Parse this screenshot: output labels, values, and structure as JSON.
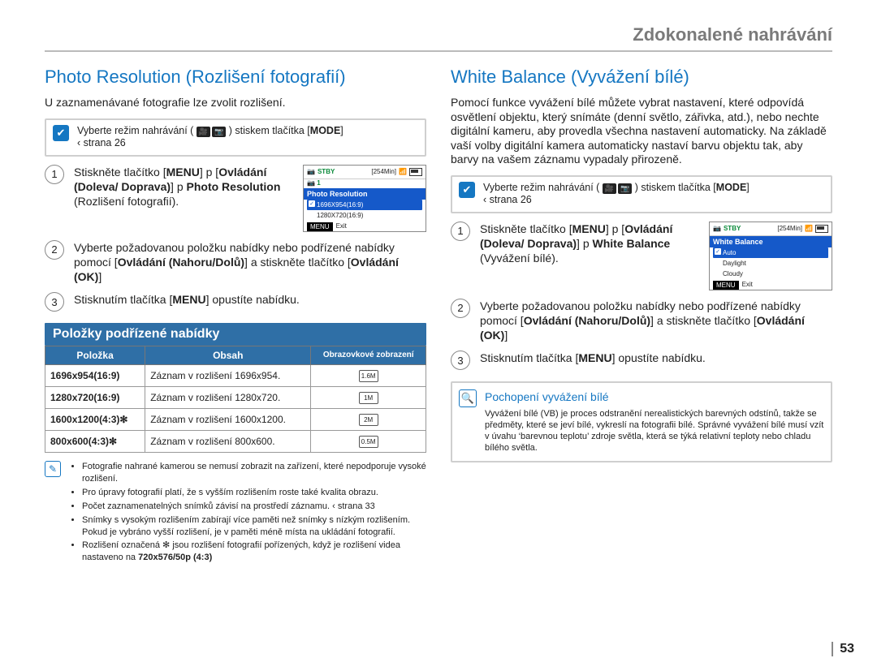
{
  "header": {
    "title": "Zdokonalené nahrávání"
  },
  "left": {
    "heading": "Photo Resolution (Rozlišení fotografií)",
    "lead": "U zaznamenávané fotografie lze zvolit rozlišení.",
    "hint_pre": "Vyberte režim nahrávání (",
    "hint_post": ") stiskem tlačítka [",
    "mode": "MODE",
    "hint_tail": "] ",
    "hint_page": "‹ strana 26",
    "step1_a": "Stiskněte tlačítko [",
    "menu": "MENU",
    "step1_b": "]  p [",
    "ctrl_lr": "Ovládání (Doleva/ Doprava)",
    "step1_c": "]  p ",
    "photo_res_b": "Photo Resolution",
    "photo_res_tail": " (Rozlišení fotografií).",
    "step2_a": "Vyberte požadovanou položku nabídky nebo podřízené nabídky pomocí [",
    "ctrl_ud": "Ovládání (Nahoru/Dolů)",
    "step2_b": "]  a stiskněte tlačítko [",
    "ctrl_ok": "Ovládání (OK)",
    "step2_c": "] ",
    "step3_a": "Stisknutím tlačítka [",
    "step3_b": "] opustíte nabídku.",
    "shot1": {
      "stby": "STBY",
      "time": "[254Min]",
      "title": "Photo Resolution",
      "sel": "1696X954(16:9)",
      "opt": "1280X720(16:9)",
      "exit": "Exit",
      "menu": "MENU"
    },
    "banner": "Položky podřízené nabídky",
    "th1": "Položka",
    "th2": "Obsah",
    "th3": "Obrazovkové zobrazení",
    "rows": [
      {
        "k": "1696x954(16:9)",
        "d": "Záznam v rozlišení 1696x954."
      },
      {
        "k": "1280x720(16:9)",
        "d": "Záznam v rozlišení 1280x720."
      },
      {
        "k": "1600x1200(4:3)✻",
        "d": "Záznam v rozlišení 1600x1200."
      },
      {
        "k": "800x600(4:3)✻",
        "d": "Záznam v rozlišení 800x600."
      }
    ],
    "notes": [
      "Fotografie nahrané kamerou se nemusí zobrazit na zařízení, které nepodporuje vysoké rozlišení.",
      "Pro úpravy fotografií platí, že s vyšším rozlišením roste také kvalita obrazu.",
      "Počet zaznamenatelných snímků závisí na prostředí záznamu.  ‹ strana 33",
      "Snímky s vysokým rozlišením zabírají více paměti než snímky s nízkým rozlišením. Pokud je vybráno vyšší rozlišení, je v paměti méně místa na ukládání fotografií."
    ],
    "note_last_pre": "Rozlišení označená ✻ jsou rozlišení fotografií pořízených, když je rozlišení videa nastaveno na ",
    "note_last_b": "720x576/50p (4:3)",
    "note_last_post": " "
  },
  "right": {
    "heading": "White Balance (Vyvážení bílé)",
    "lead": "Pomocí funkce vyvážení bílé můžete vybrat nastavení, které odpovídá osvětlení objektu, který snímáte (denní světlo, zářivka, atd.), nebo nechte digitální kameru, aby provedla všechna nastavení automaticky. Na základě vaší volby digitální kamera automaticky nastaví barvu objektu tak, aby barvy na vašem záznamu vypadaly přirozeně.",
    "hint_pre": "Vyberte režim nahrávání (",
    "hint_post": ") stiskem tlačítka [",
    "mode": "MODE",
    "hint_tail": "] ",
    "hint_page": "‹ strana 26",
    "step1_a": "Stiskněte tlačítko [",
    "menu": "MENU",
    "step1_b": "]  p [",
    "ctrl_lr": "Ovládání (Doleva/ Doprava)",
    "step1_c": "]  p ",
    "wb_b": "White Balance",
    "wb_tail": " (Vyvážení bílé).",
    "step2_a": "Vyberte požadovanou položku nabídky nebo podřízené nabídky pomocí [",
    "ctrl_ud": "Ovládání (Nahoru/Dolů)",
    "step2_b": "]  a stiskněte tlačítko [",
    "ctrl_ok": "Ovládání (OK)",
    "step2_c": "] ",
    "step3_a": "Stisknutím tlačítka [",
    "step3_b": "] opustíte nabídku.",
    "shot2": {
      "stby": "STBY",
      "time": "[254Min]",
      "title": "White Balance",
      "sel": "Auto",
      "opt1": "Daylight",
      "opt2": "Cloudy",
      "exit": "Exit",
      "menu": "MENU"
    },
    "info_title": "Pochopení vyvážení bílé",
    "info_body": "Vyvážení bílé (VB) je proces odstranění nerealistických barevných odstínů, takže se předměty, které se jeví bílé, vykreslí na fotografii bílé. Správné vyvážení bílé musí vzít v úvahu ‘barevnou teplotu’ zdroje světla, která se týká relativní teploty nebo chladu bílého světla."
  },
  "pagenum": "53"
}
